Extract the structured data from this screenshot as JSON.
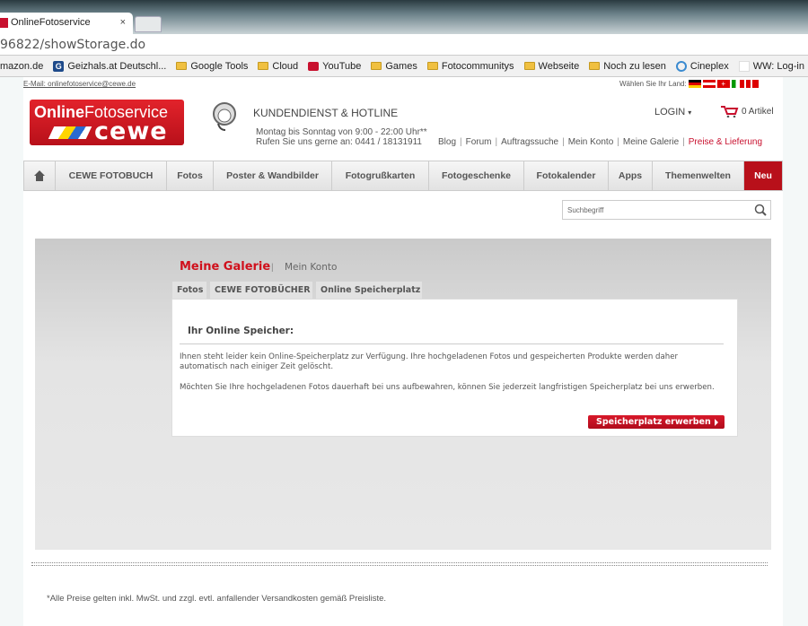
{
  "browser": {
    "tab_title": "OnlineFotoservice",
    "tab_close": "×",
    "address": "96822/showStorage.do",
    "bookmarks": [
      {
        "label": "mazon.de",
        "icon": "none"
      },
      {
        "label": "Geizhals.at Deutschl...",
        "icon": "geizhals-icon"
      },
      {
        "label": "Google Tools",
        "icon": "folder-icon"
      },
      {
        "label": "Cloud",
        "icon": "folder-icon"
      },
      {
        "label": "YouTube",
        "icon": "youtube-icon"
      },
      {
        "label": "Games",
        "icon": "folder-icon"
      },
      {
        "label": "Fotocommunitys",
        "icon": "folder-icon"
      },
      {
        "label": "Webseite",
        "icon": "folder-icon"
      },
      {
        "label": "Noch zu lesen",
        "icon": "folder-icon"
      },
      {
        "label": "Cineplex",
        "icon": "cineplex-icon"
      },
      {
        "label": "WW: Log-in",
        "icon": "page-icon"
      }
    ]
  },
  "header": {
    "email": "E-Mail: onlinefotoservice@cewe.de",
    "country_label": "Wählen Sie Ihr Land:",
    "logo": {
      "line1_bold": "Online",
      "line1": "Fotoservice",
      "line2": "cewe"
    },
    "hotline_title": "KUNDENDIENST & HOTLINE",
    "hours": "Montag bis Sonntag von 9:00 - 22:00 Uhr**",
    "phone": "Rufen Sie uns gerne an: 0441 / 18131911",
    "links": [
      "Blog",
      "Forum",
      "Auftragssuche",
      "Mein Konto",
      "Meine Galerie",
      "Preise & Lieferung"
    ],
    "login": "LOGIN",
    "cart": "0 Artikel"
  },
  "nav": [
    "CEWE FOTOBUCH",
    "Fotos",
    "Poster & Wandbilder",
    "Fotogrußkarten",
    "Fotogeschenke",
    "Fotokalender",
    "Apps",
    "Themenwelten",
    "Neu"
  ],
  "search": {
    "placeholder": "Suchbegriff"
  },
  "gallery": {
    "title": "Meine Galerie",
    "sep": "|",
    "account": "Mein Konto",
    "tabs": [
      "Fotos",
      "CEWE FOTOBÜCHER",
      "Online Speicherplatz"
    ],
    "heading": "Ihr Online Speicher:",
    "para1": "Ihnen steht leider kein Online-Speicherplatz zur Verfügung. Ihre hochgeladenen Fotos und gespeicherten Produkte werden daher automatisch nach einiger Zeit gelöscht.",
    "para2": "Möchten Sie Ihre hochgeladenen Fotos dauerhaft bei uns aufbewahren, können Sie jederzeit langfristigen Speicherplatz bei uns erwerben.",
    "button": "Speicherplatz erwerben"
  },
  "footer": "*Alle Preise gelten inkl. MwSt. und zzgl. evtl. anfallender Versandkosten gemäß Preisliste.",
  "colors": {
    "brand": "#c8102e"
  }
}
